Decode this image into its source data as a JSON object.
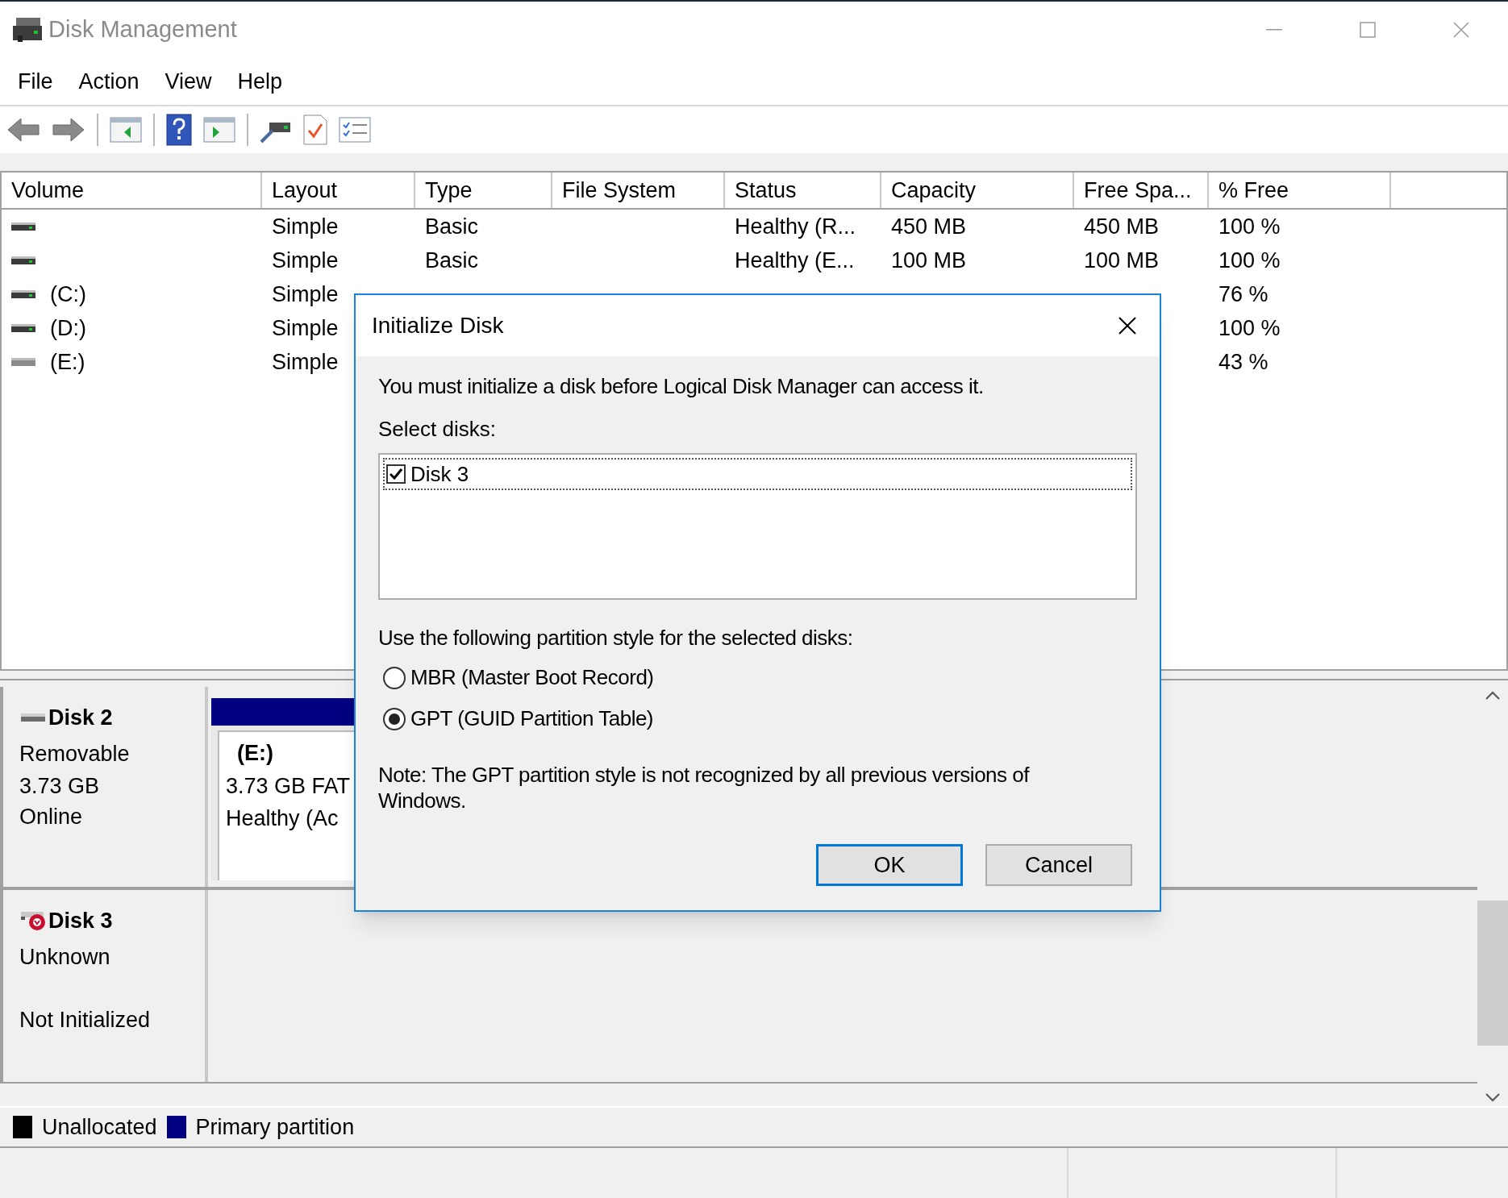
{
  "window": {
    "title": "Disk Management"
  },
  "menu": [
    "File",
    "Action",
    "View",
    "Help"
  ],
  "table": {
    "columns": [
      "Volume",
      "Layout",
      "Type",
      "File System",
      "Status",
      "Capacity",
      "Free Spa...",
      "% Free"
    ],
    "rows": [
      {
        "kind": "fixed",
        "cells": [
          null,
          "Simple",
          "Basic",
          null,
          "Healthy (R...",
          "450 MB",
          "450 MB",
          "100 %"
        ]
      },
      {
        "kind": "fixed",
        "cells": [
          null,
          "Simple",
          "Basic",
          null,
          "Healthy (E...",
          "100 MB",
          "100 MB",
          "100 %"
        ]
      },
      {
        "kind": "fixed",
        "cells": [
          "(C:)",
          "Simple",
          null,
          null,
          null,
          null,
          null,
          "76 %"
        ]
      },
      {
        "kind": "fixed",
        "cells": [
          "(D:)",
          "Simple",
          null,
          null,
          null,
          null,
          null,
          "100 %"
        ]
      },
      {
        "kind": "removable",
        "cells": [
          "(E:)",
          "Simple",
          null,
          null,
          null,
          null,
          null,
          "43 %"
        ]
      }
    ]
  },
  "disks": [
    {
      "kind": "removable",
      "name": "Disk 2",
      "type": "Removable",
      "size": "3.73 GB",
      "status": "Online",
      "partitions": [
        {
          "label": "(E:)",
          "detail": "3.73 GB FAT",
          "status": "Healthy (Ac",
          "color": "#000080"
        }
      ]
    },
    {
      "kind": "uninitialized",
      "name": "Disk 3",
      "type": "Unknown",
      "status": "Not Initialized"
    }
  ],
  "legend": [
    {
      "label": "Unallocated",
      "color": "#000000"
    },
    {
      "label": "Primary partition",
      "color": "#000080"
    }
  ],
  "dialog": {
    "title": "Initialize Disk",
    "message": "You must initialize a disk before Logical Disk Manager can access it.",
    "select_label": "Select disks:",
    "disks": [
      {
        "label": "Disk 3",
        "checked": true
      }
    ],
    "style_label": "Use the following partition style for the selected disks:",
    "options": [
      {
        "label": "MBR (Master Boot Record)",
        "selected": false
      },
      {
        "label": "GPT (GUID Partition Table)",
        "selected": true
      }
    ],
    "note": "Note: The GPT partition style is not recognized by all previous versions of Windows.",
    "buttons": [
      {
        "label": "OK",
        "default": true
      },
      {
        "label": "Cancel",
        "default": false
      }
    ]
  }
}
